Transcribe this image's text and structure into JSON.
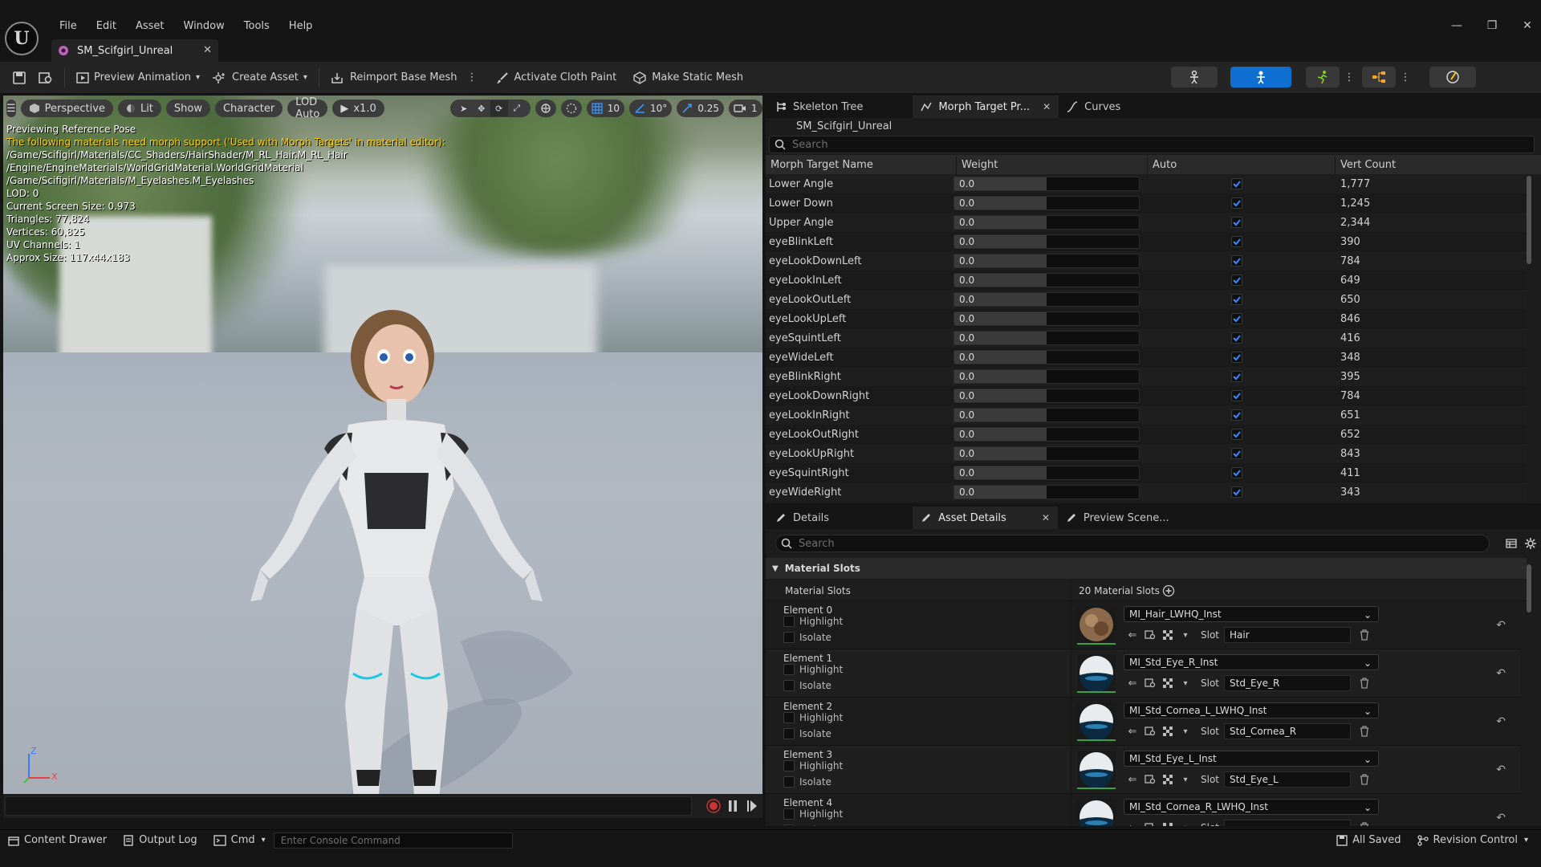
{
  "app": {
    "menu": [
      "File",
      "Edit",
      "Asset",
      "Window",
      "Tools",
      "Help"
    ],
    "doc_tab": "SM_Scifgirl_Unreal",
    "window_controls": {
      "minimize": "—",
      "restore": "❐",
      "close": "✕"
    }
  },
  "toolbar": {
    "preview_animation": "Preview Animation",
    "create_asset": "Create Asset",
    "reimport_base_mesh": "Reimport Base Mesh",
    "activate_cloth_paint": "Activate Cloth Paint",
    "make_static_mesh": "Make Static Mesh",
    "colors": {
      "active_mode": "#0e6fd1"
    }
  },
  "viewport": {
    "perspective": "Perspective",
    "lit": "Lit",
    "show": "Show",
    "character": "Character",
    "lod": "LOD Auto",
    "play_speed": "x1.0",
    "grid_snap": "10",
    "angle_snap": "10°",
    "scale_snap": "0.25",
    "camera_speed": "1",
    "info": [
      {
        "text": "Previewing Reference Pose",
        "warn": false
      },
      {
        "text": "The following materials need morph support ('Used with Morph Targets' in material editor):",
        "warn": true
      },
      {
        "text": "/Game/Scifigirl/Materials/CC_Shaders/HairShader/M_RL_Hair.M_RL_Hair",
        "warn": false
      },
      {
        "text": "/Engine/EngineMaterials/WorldGridMaterial.WorldGridMaterial",
        "warn": false
      },
      {
        "text": "/Game/Scifigirl/Materials/M_Eyelashes.M_Eyelashes",
        "warn": false
      },
      {
        "text": "LOD: 0",
        "warn": false
      },
      {
        "text": "Current Screen Size: 0.973",
        "warn": false
      },
      {
        "text": "Triangles: 77,824",
        "warn": false
      },
      {
        "text": "Vertices: 60,825",
        "warn": false
      },
      {
        "text": "UV Channels: 1",
        "warn": false
      },
      {
        "text": "Approx Size: 117x44x183",
        "warn": false
      }
    ],
    "axis_z": "Z",
    "axis_x": "X"
  },
  "morph_panel": {
    "tabs": [
      {
        "label": "Skeleton Tree",
        "active": false
      },
      {
        "label": "Morph Target Pr...",
        "active": true
      },
      {
        "label": "Curves",
        "active": false
      }
    ],
    "mesh_name": "SM_Scifgirl_Unreal",
    "search_placeholder": "Search",
    "columns": [
      "Morph Target Name",
      "Weight",
      "Auto",
      "Vert Count"
    ],
    "rows": [
      {
        "name": "Lower Angle",
        "weight": "0.0",
        "verts": "1,777"
      },
      {
        "name": "Lower Down",
        "weight": "0.0",
        "verts": "1,245"
      },
      {
        "name": "Upper Angle",
        "weight": "0.0",
        "verts": "2,344"
      },
      {
        "name": "eyeBlinkLeft",
        "weight": "0.0",
        "verts": "390"
      },
      {
        "name": "eyeLookDownLeft",
        "weight": "0.0",
        "verts": "784"
      },
      {
        "name": "eyeLookInLeft",
        "weight": "0.0",
        "verts": "649"
      },
      {
        "name": "eyeLookOutLeft",
        "weight": "0.0",
        "verts": "650"
      },
      {
        "name": "eyeLookUpLeft",
        "weight": "0.0",
        "verts": "846"
      },
      {
        "name": "eyeSquintLeft",
        "weight": "0.0",
        "verts": "416"
      },
      {
        "name": "eyeWideLeft",
        "weight": "0.0",
        "verts": "348"
      },
      {
        "name": "eyeBlinkRight",
        "weight": "0.0",
        "verts": "395"
      },
      {
        "name": "eyeLookDownRight",
        "weight": "0.0",
        "verts": "784"
      },
      {
        "name": "eyeLookInRight",
        "weight": "0.0",
        "verts": "651"
      },
      {
        "name": "eyeLookOutRight",
        "weight": "0.0",
        "verts": "652"
      },
      {
        "name": "eyeLookUpRight",
        "weight": "0.0",
        "verts": "843"
      },
      {
        "name": "eyeSquintRight",
        "weight": "0.0",
        "verts": "411"
      },
      {
        "name": "eyeWideRight",
        "weight": "0.0",
        "verts": "343"
      }
    ]
  },
  "details_panel": {
    "tabs": [
      {
        "label": "Details",
        "active": false
      },
      {
        "label": "Asset Details",
        "active": true
      },
      {
        "label": "Preview Scene...",
        "active": false
      }
    ],
    "search_placeholder": "Search",
    "section": "Material Slots",
    "slots_label": "Material Slots",
    "slots_count": "20 Material Slots",
    "highlight_label": "Highlight",
    "isolate_label": "Isolate",
    "slot_label": "Slot",
    "elements": [
      {
        "name": "Element 0",
        "material": "MI_Hair_LWHQ_Inst",
        "slot": "Hair",
        "thumb": "hair"
      },
      {
        "name": "Element 1",
        "material": "MI_Std_Eye_R_Inst",
        "slot": "Std_Eye_R",
        "thumb": "eye"
      },
      {
        "name": "Element 2",
        "material": "MI_Std_Cornea_L_LWHQ_Inst",
        "slot": "Std_Cornea_R",
        "thumb": "eye"
      },
      {
        "name": "Element 3",
        "material": "MI_Std_Eye_L_Inst",
        "slot": "Std_Eye_L",
        "thumb": "eye"
      },
      {
        "name": "Element 4",
        "material": "MI_Std_Cornea_R_LWHQ_Inst",
        "slot": "",
        "thumb": "eye"
      }
    ]
  },
  "statusbar": {
    "content_drawer": "Content Drawer",
    "output_log": "Output Log",
    "cmd": "Cmd",
    "console_placeholder": "Enter Console Command",
    "all_saved": "All Saved",
    "revision_control": "Revision Control"
  }
}
